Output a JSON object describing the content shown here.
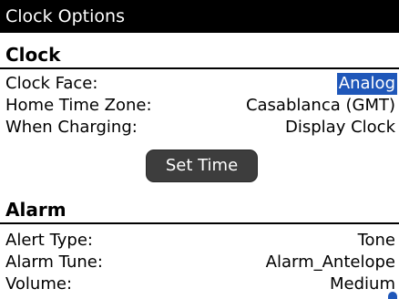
{
  "title": "Clock Options",
  "clock": {
    "header": "Clock",
    "rows": [
      {
        "label": "Clock Face:",
        "value": "Analog"
      },
      {
        "label": "Home Time Zone:",
        "value": "Casablanca (GMT)"
      },
      {
        "label": "When Charging:",
        "value": "Display Clock"
      }
    ],
    "set_time_label": "Set Time"
  },
  "alarm": {
    "header": "Alarm",
    "rows": [
      {
        "label": "Alert Type:",
        "value": "Tone"
      },
      {
        "label": "Alarm Tune:",
        "value": "Alarm_Antelope"
      },
      {
        "label": "Volume:",
        "value": "Medium"
      }
    ]
  },
  "colors": {
    "selection": "#1f57b9",
    "titlebar": "#000000",
    "button": "#3d3d3d"
  }
}
